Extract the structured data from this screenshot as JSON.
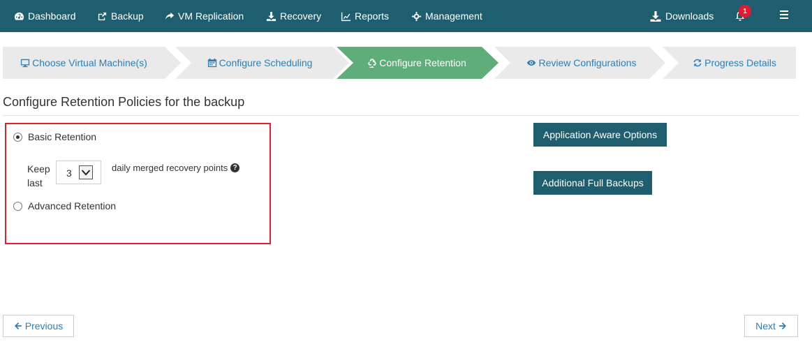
{
  "nav": {
    "items": [
      {
        "label": "Dashboard",
        "icon": "dashboard-icon"
      },
      {
        "label": "Backup",
        "icon": "backup-icon"
      },
      {
        "label": "VM Replication",
        "icon": "share-icon"
      },
      {
        "label": "Recovery",
        "icon": "download-icon"
      },
      {
        "label": "Reports",
        "icon": "chart-icon"
      },
      {
        "label": "Management",
        "icon": "crosshairs-icon"
      }
    ],
    "downloads_label": "Downloads",
    "notification_count": "1"
  },
  "wizard": {
    "steps": [
      {
        "label": "Choose Virtual Machine(s)",
        "icon": "monitor-icon",
        "active": false
      },
      {
        "label": "Configure Scheduling",
        "icon": "calendar-icon",
        "active": false
      },
      {
        "label": "Configure Retention",
        "icon": "recycle-icon",
        "active": true
      },
      {
        "label": "Review Configurations",
        "icon": "eye-icon",
        "active": false
      },
      {
        "label": "Progress Details",
        "icon": "refresh-icon",
        "active": false
      }
    ]
  },
  "section": {
    "title": "Configure Retention Policies for the backup"
  },
  "retention": {
    "basic_label": "Basic Retention",
    "keep_last_label": "Keep last",
    "keep_value": "3",
    "daily_text": "daily merged recovery points",
    "help_glyph": "?",
    "advanced_label": "Advanced Retention"
  },
  "actions": {
    "app_aware_label": "Application Aware Options",
    "additional_full_label": "Additional Full Backups"
  },
  "footer": {
    "previous_label": "Previous",
    "next_label": "Next"
  },
  "colors": {
    "nav_bg": "#1f5e6e",
    "active_step": "#5fae7a",
    "inactive_step": "#eaeaea",
    "link_blue": "#2b7fb8",
    "highlight_red": "#e1202b"
  }
}
